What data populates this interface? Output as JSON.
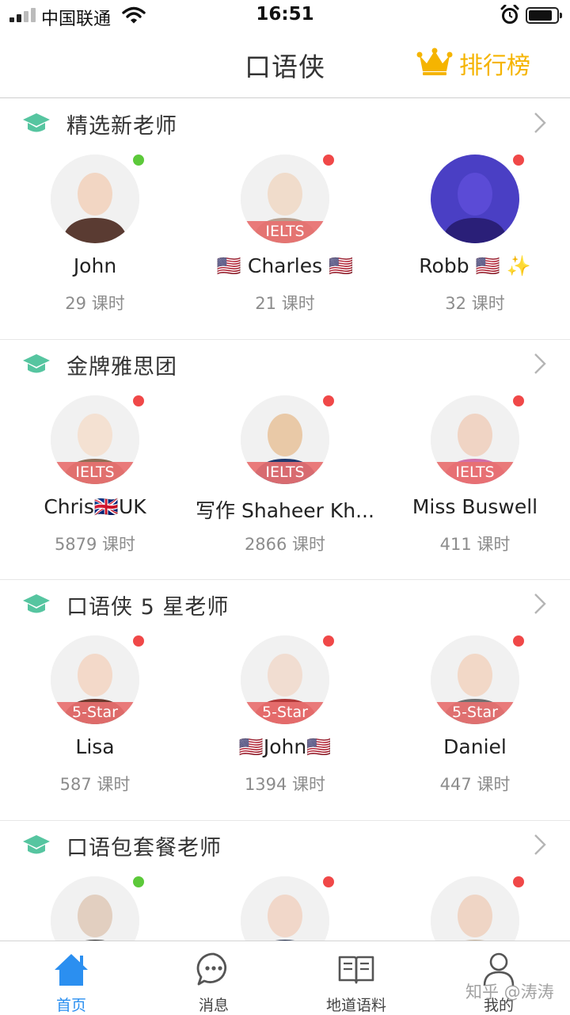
{
  "status_bar": {
    "carrier": "中国联通",
    "time": "16:51",
    "battery_percent": 85
  },
  "nav": {
    "title": "口语侠",
    "rank_label": "排行榜"
  },
  "colors": {
    "accent_gold": "#f5b400",
    "tab_active": "#2b8ff0",
    "online": "#5cc93a",
    "offline": "#f04848",
    "badge": "#e87070",
    "section_icon": "#56c5a0"
  },
  "sections": [
    {
      "title": "精选新老师",
      "teachers": [
        {
          "name": "John",
          "hours": "29 课时",
          "status": "online",
          "badge": ""
        },
        {
          "name": "🇺🇸 Charles 🇺🇸",
          "hours": "21 课时",
          "status": "offline",
          "badge": "IELTS"
        },
        {
          "name": "Robb 🇺🇸 ✨",
          "hours": "32 课时",
          "status": "offline",
          "badge": ""
        }
      ]
    },
    {
      "title": "金牌雅思团",
      "teachers": [
        {
          "name": "Chris🇬🇧UK",
          "hours": "5879 课时",
          "status": "offline",
          "badge": "IELTS"
        },
        {
          "name": "写作 Shaheer Kh...",
          "hours": "2866 课时",
          "status": "offline",
          "badge": "IELTS"
        },
        {
          "name": "Miss Buswell",
          "hours": "411 课时",
          "status": "offline",
          "badge": "IELTS"
        }
      ]
    },
    {
      "title": "口语侠 5 星老师",
      "teachers": [
        {
          "name": "Lisa",
          "hours": "587 课时",
          "status": "offline",
          "badge": "5-Star"
        },
        {
          "name": "🇺🇸John🇺🇸",
          "hours": "1394 课时",
          "status": "offline",
          "badge": "5-Star"
        },
        {
          "name": "Daniel",
          "hours": "447 课时",
          "status": "offline",
          "badge": "5-Star"
        }
      ]
    },
    {
      "title": "口语包套餐老师",
      "teachers": [
        {
          "name": "",
          "hours": "",
          "status": "online",
          "badge": ""
        },
        {
          "name": "",
          "hours": "",
          "status": "offline",
          "badge": ""
        },
        {
          "name": "",
          "hours": "",
          "status": "offline",
          "badge": ""
        }
      ]
    }
  ],
  "tabs": [
    {
      "label": "首页",
      "icon": "home-icon",
      "active": true
    },
    {
      "label": "消息",
      "icon": "chat-bubble-icon",
      "active": false
    },
    {
      "label": "地道语料",
      "icon": "open-book-icon",
      "active": false
    },
    {
      "label": "我的",
      "icon": "person-icon",
      "active": false
    }
  ],
  "watermark": "知乎 @涛涛"
}
